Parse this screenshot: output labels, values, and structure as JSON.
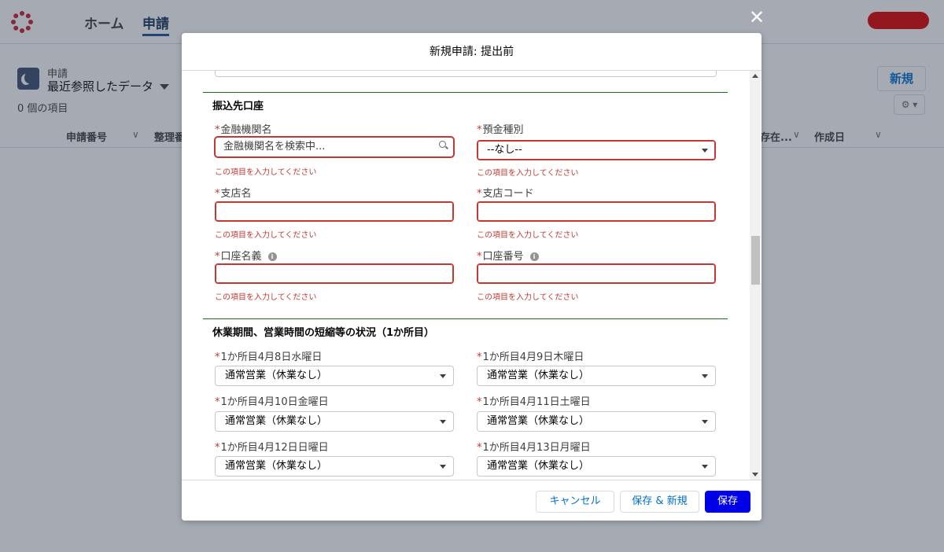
{
  "topbar": {
    "nav_home": "ホーム",
    "nav_app": "申請"
  },
  "list": {
    "object_label": "申請",
    "view_name": "最近参照したデータ",
    "item_count": "0 個の項目",
    "new_button": "新規",
    "columns": [
      "申請番号",
      "整理番",
      "存在...",
      "作成日"
    ]
  },
  "modal": {
    "title": "新規申請: 提出前",
    "sections": {
      "bank": {
        "title": "振込先口座",
        "fields": {
          "bank_name": {
            "label": "金融機関名",
            "placeholder": "金融機関名を検索中...",
            "error": "この項目を入力してください"
          },
          "deposit_type": {
            "label": "預金種別",
            "value": "--なし--",
            "error": "この項目を入力してください"
          },
          "branch_name": {
            "label": "支店名",
            "value": "",
            "error": "この項目を入力してください"
          },
          "branch_code": {
            "label": "支店コード",
            "value": "",
            "error": "この項目を入力してください"
          },
          "account_holder": {
            "label": "口座名義",
            "value": "",
            "error": "この項目を入力してください"
          },
          "account_number": {
            "label": "口座番号",
            "value": "",
            "error": "この項目を入力してください"
          }
        }
      },
      "closure": {
        "title": "休業期間、営業時間の短縮等の状況（1か所目）",
        "days": [
          {
            "label": "1か所目4月8日水曜日",
            "value": "通常営業（休業なし）"
          },
          {
            "label": "1か所目4月9日木曜日",
            "value": "通常営業（休業なし）"
          },
          {
            "label": "1か所目4月10日金曜日",
            "value": "通常営業（休業なし）"
          },
          {
            "label": "1か所目4月11日土曜日",
            "value": "通常営業（休業なし）"
          },
          {
            "label": "1か所目4月12日日曜日",
            "value": "通常営業（休業なし）"
          },
          {
            "label": "1か所目4月13日月曜日",
            "value": "通常営業（休業なし）"
          }
        ]
      }
    },
    "footer": {
      "cancel": "キャンセル",
      "save_new": "保存 & 新規",
      "save": "保存"
    }
  },
  "colors": {
    "brand_button": "#0000e6",
    "error": "#c23934",
    "section_rule": "#1a6e1a",
    "link": "#0070d2"
  }
}
